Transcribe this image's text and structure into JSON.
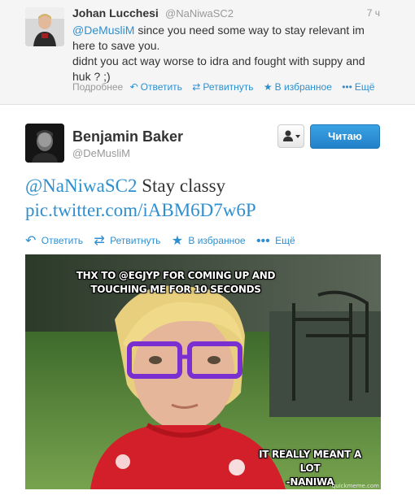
{
  "reply": {
    "name": "Johan Lucchesi",
    "handle": "@NaNiwaSC2",
    "time": "7 ч",
    "text_mention": "@DeMusliM",
    "text_line1": " since you need some way to stay relevant im",
    "text_line2": "here to save you.",
    "text_line3": "didnt you act way worse to idra  and fought with suppy and",
    "text_line4": "huk ? ;)",
    "actions": {
      "details": "Подробнее",
      "reply": "Ответить",
      "retweet": "Ретвитнуть",
      "favorite": "В избранное",
      "more": "Ещё"
    }
  },
  "tweet": {
    "name": "Benjamin Baker",
    "handle": "@DeMusliM",
    "follow_label": "Читаю",
    "text_mention": "@NaNiwaSC2",
    "text_body": " Stay classy",
    "text_link": "pic.twitter.com/iABM6D7w6P",
    "actions": {
      "reply": "Ответить",
      "retweet": "Ретвитнуть",
      "favorite": "В избранное",
      "more": "Ещё"
    }
  },
  "meme": {
    "caption_top_line1": "THX TO @EGJYP FOR COMING UP AND",
    "caption_top_line2": "TOUCHING ME FOR 10 SECONDS",
    "caption_bottom_line1": "IT REALLY MEANT A LOT",
    "caption_bottom_line2": "-NANIWA",
    "watermark": "quickmeme.com"
  },
  "icons": {
    "reply": "reply-icon",
    "retweet": "retweet-icon",
    "favorite": "star-icon",
    "more": "more-dots-icon",
    "user": "user-icon",
    "dropdown": "caret-down-icon"
  },
  "colors": {
    "link": "#2f8fce",
    "follow_button": "#2a8ad2",
    "muted_text": "#999999"
  }
}
